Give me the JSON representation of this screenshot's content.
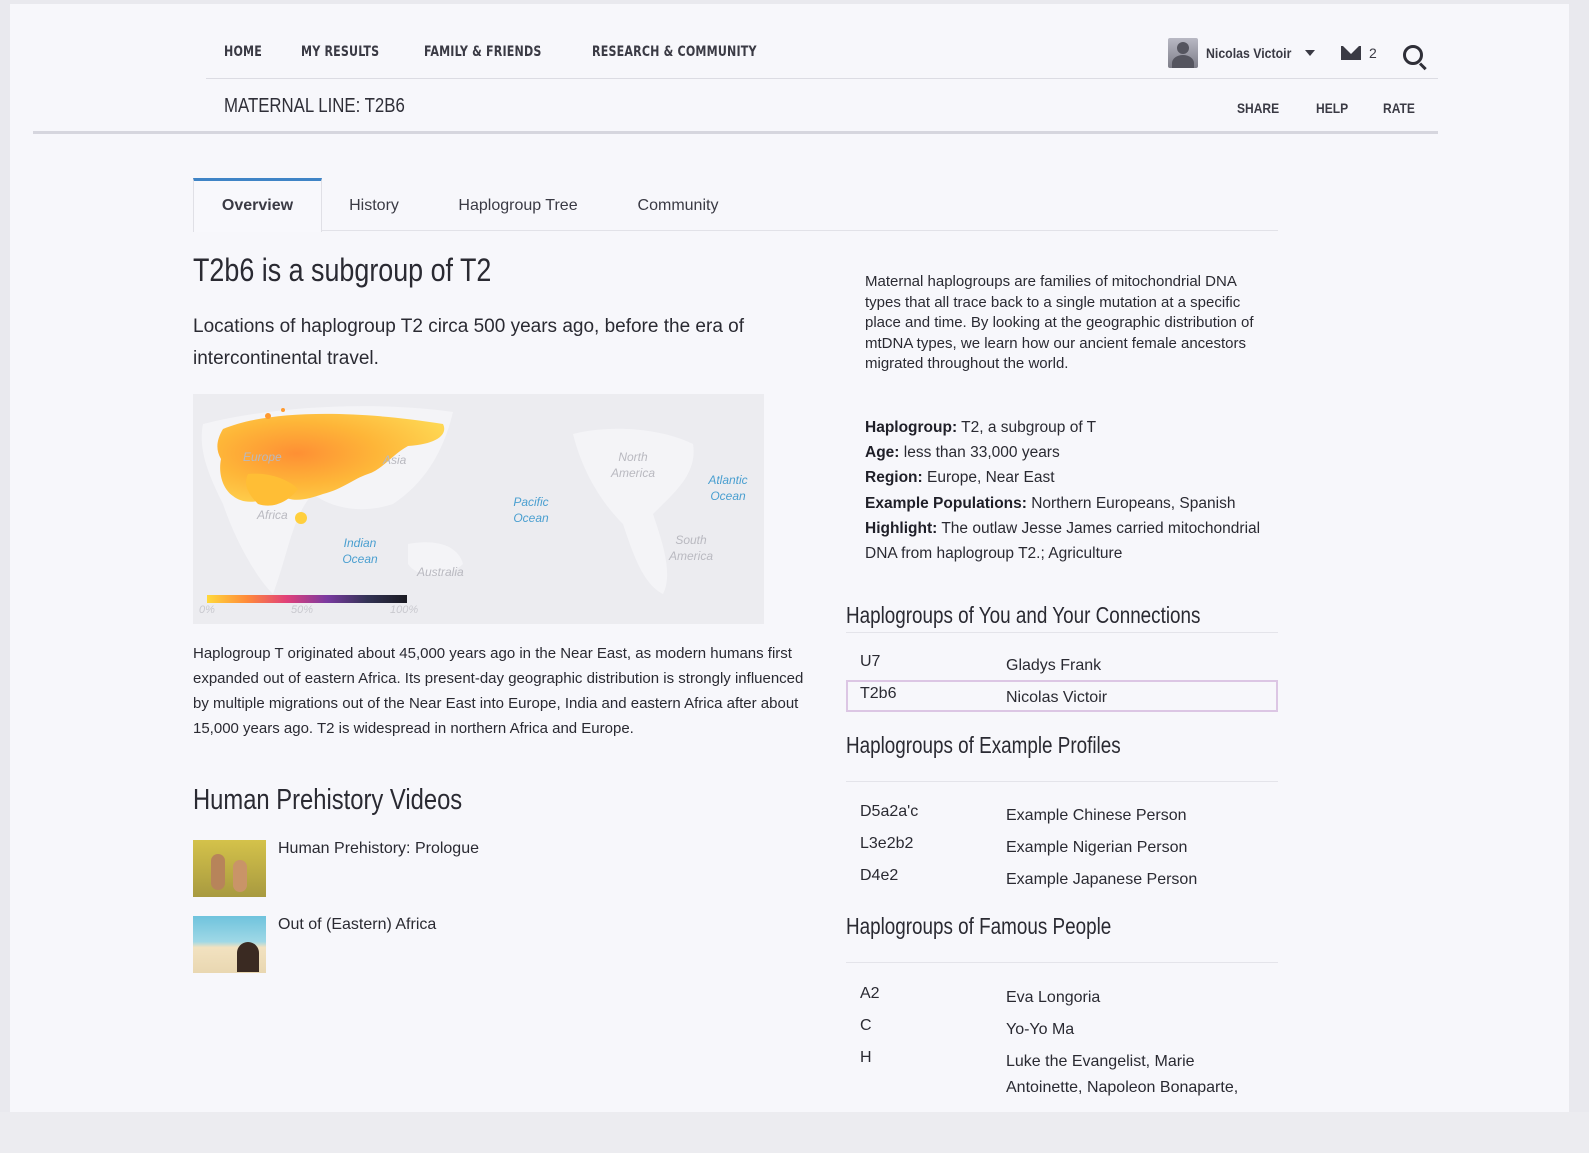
{
  "nav": {
    "items": [
      "HOME",
      "MY RESULTS",
      "FAMILY & FRIENDS",
      "RESEARCH & COMMUNITY"
    ],
    "user_name": "Nicolas Victoir",
    "message_count": "2"
  },
  "subbar": {
    "title": "MATERNAL LINE: T2B6",
    "links": [
      "SHARE",
      "HELP",
      "RATE"
    ]
  },
  "tabs": [
    "Overview",
    "History",
    "Haplogroup Tree",
    "Community"
  ],
  "main": {
    "heading": "T2b6 is a subgroup of T2",
    "lead": "Locations of haplogroup T2 circa 500 years ago, before the era of intercontinental travel.",
    "map": {
      "labels": [
        "Europe",
        "Asia",
        "Africa",
        "North America",
        "South America",
        "Australia"
      ],
      "oceans": [
        "Pacific Ocean",
        "Atlantic Ocean",
        "Indian Ocean"
      ],
      "legend": [
        "0%",
        "50%",
        "100%"
      ]
    },
    "body": "Haplogroup T originated about 45,000 years ago in the Near East, as modern humans first expanded out of eastern Africa. Its present-day geographic distribution is strongly influenced by multiple migrations out of the Near East into Europe, India and eastern Africa after about 15,000 years ago. T2 is widespread in northern Africa and Europe.",
    "videos_heading": "Human Prehistory Videos",
    "videos": [
      "Human Prehistory: Prologue",
      "Out of (Eastern) Africa"
    ]
  },
  "side": {
    "intro": "Maternal haplogroups are families of mitochondrial DNA types that all trace back to a single mutation at a specific place and time. By looking at the geographic distribution of mtDNA types, we learn how our ancient female ancestors migrated throughout the world.",
    "facts": [
      {
        "label": "Haplogroup:",
        "value": " T2, a subgroup of T"
      },
      {
        "label": "Age:",
        "value": " less than 33,000 years"
      },
      {
        "label": "Region:",
        "value": " Europe, Near East"
      },
      {
        "label": "Example Populations:",
        "value": " Northern Europeans, Spanish"
      },
      {
        "label": "Highlight:",
        "value": " The outlaw Jesse James carried mitochondrial DNA from haplogroup T2.; Agriculture"
      }
    ],
    "connections_title": "Haplogroups of You and Your Connections",
    "connections": [
      {
        "haplogroup": "U7",
        "name": "Gladys Frank"
      },
      {
        "haplogroup": "T2b6",
        "name": "Nicolas Victoir"
      }
    ],
    "examples_title": "Haplogroups of Example Profiles",
    "examples": [
      {
        "haplogroup": "D5a2a'c",
        "name": "Example Chinese Person"
      },
      {
        "haplogroup": "L3e2b2",
        "name": "Example Nigerian Person"
      },
      {
        "haplogroup": "D4e2",
        "name": "Example Japanese Person"
      }
    ],
    "famous_title": "Haplogroups of Famous People",
    "famous": [
      {
        "haplogroup": "A2",
        "name": "Eva Longoria"
      },
      {
        "haplogroup": "C",
        "name": "Yo-Yo Ma"
      },
      {
        "haplogroup": "H",
        "name": "Luke the Evangelist, Marie Antoinette, Napoleon Bonaparte,"
      }
    ]
  },
  "colors": {
    "accent_tab": "#3f84c6",
    "selected_row_border": "#dcc6e4",
    "ocean_label": "#4a9fd0"
  }
}
